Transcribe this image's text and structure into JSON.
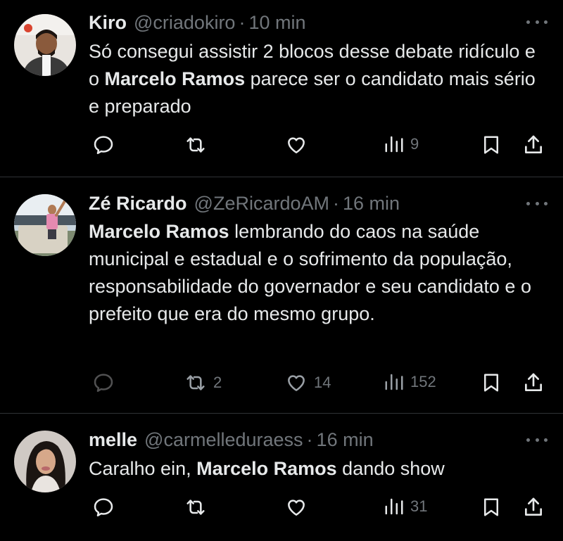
{
  "tweets": [
    {
      "name": "Kiro",
      "handle": "@criadokiro",
      "separator": "·",
      "time": "10 min",
      "text_parts": [
        "Só consegui assistir 2 blocos desse debate ridículo e o ",
        "Marcelo Ramos",
        " parece ser o candidato mais sério e preparado"
      ],
      "actions": {
        "reply": "",
        "retweet": "",
        "like": "",
        "views": "9"
      }
    },
    {
      "name": "Zé Ricardo",
      "handle": "@ZeRicardoAM",
      "separator": "·",
      "time": "16 min",
      "text_parts": [
        "",
        "Marcelo Ramos",
        " lembrando do caos na saúde municipal e estadual e o sofrimento da população, responsabilidade do governador e seu candidato e o prefeito que era do mesmo grupo."
      ],
      "actions": {
        "reply": "",
        "retweet": "2",
        "like": "14",
        "views": "152"
      }
    },
    {
      "name": "melle",
      "handle": "@carmelleduraess",
      "separator": "·",
      "time": "16 min",
      "text_parts": [
        "Caralho ein, ",
        "Marcelo Ramos",
        " dando show"
      ],
      "actions": {
        "reply": "",
        "retweet": "",
        "like": "",
        "views": "31"
      }
    }
  ],
  "icons": {
    "reply": "reply-icon",
    "retweet": "retweet-icon",
    "like": "heart-icon",
    "views": "views-icon",
    "bookmark": "bookmark-icon",
    "share": "share-icon",
    "more": "more-dots-icon"
  },
  "colors": {
    "background": "#000000",
    "text": "#e7e9ea",
    "secondary": "#71767b",
    "divider": "#2f3336"
  }
}
